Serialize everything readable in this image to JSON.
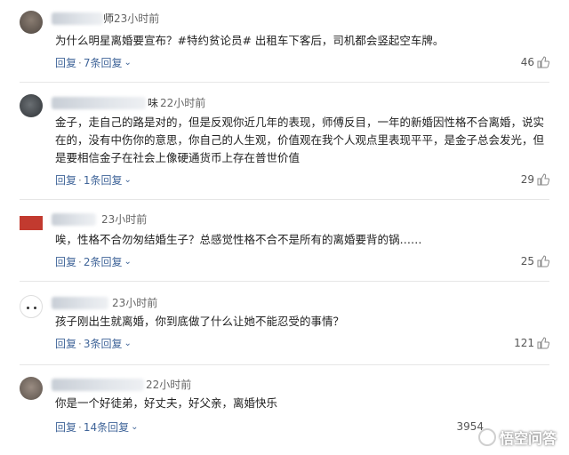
{
  "comments": [
    {
      "time": "23小时前",
      "name_tail": "师",
      "text": "为什么明星离婚要宣布？#特约贫论员# 出租车下客后，司机都会竖起空车牌。",
      "reply": "回复",
      "replies": "7条回复",
      "likes": "46"
    },
    {
      "time": "22小时前",
      "name_tail": "味",
      "text": "金子，走自己的路是对的，但是反观你近几年的表现，师傅反目，一年的新婚因性格不合离婚，说实在的，没有中伤你的意思，你自己的人生观，价值观在我个人观点里表现平平，是金子总会发光，但是要相信金子在社会上像硬通货币上存在普世价值",
      "reply": "回复",
      "replies": "1条回复",
      "likes": "29"
    },
    {
      "time": "23小时前",
      "name_tail": "",
      "text": "唉，性格不合勿匆结婚生子？总感觉性格不合不是所有的离婚要背的锅……",
      "reply": "回复",
      "replies": "2条回复",
      "likes": "25"
    },
    {
      "time": "23小时前",
      "name_tail": "",
      "text": "孩子刚出生就离婚，你到底做了什么让她不能忍受的事情？",
      "reply": "回复",
      "replies": "3条回复",
      "likes": "121"
    },
    {
      "time": "22小时前",
      "name_tail": "",
      "text": "你是一个好徒弟，好丈夫，好父亲，离婚快乐",
      "reply": "回复",
      "replies": "14条回复",
      "likes": "3954"
    }
  ],
  "watermark": "悟空问答",
  "icons": {
    "like": "thumbs-up-icon",
    "expand": "chevron-down-icon"
  },
  "colors": {
    "link": "#406599",
    "text": "#222222",
    "muted": "#666666"
  }
}
